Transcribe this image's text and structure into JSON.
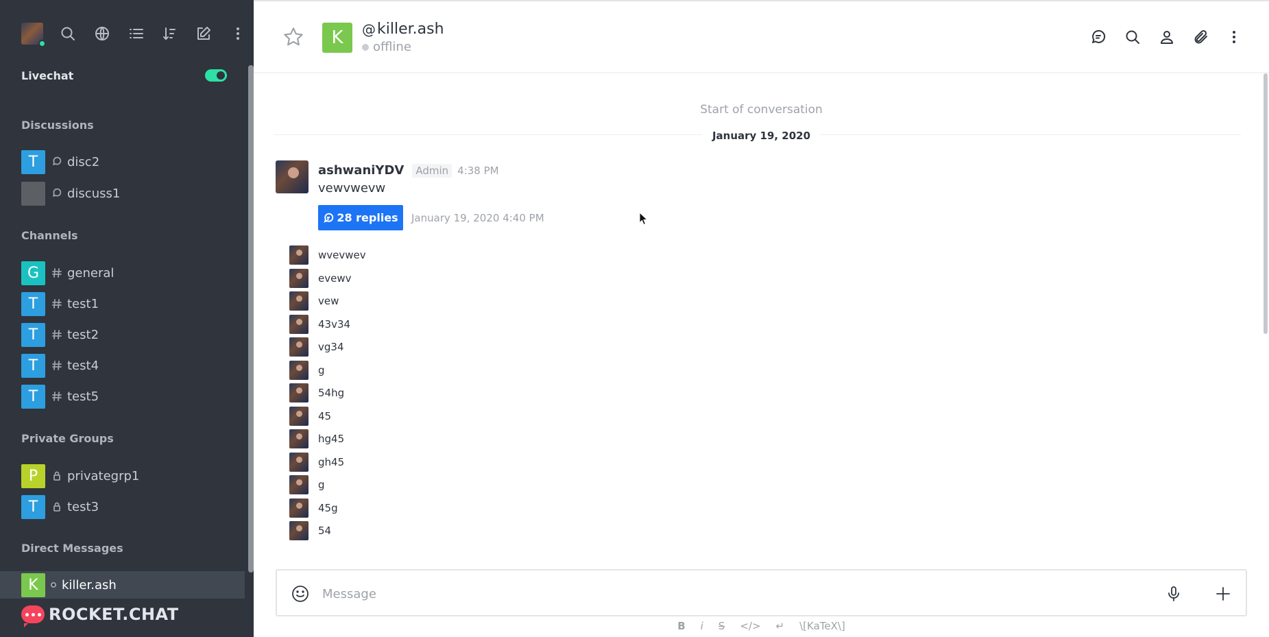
{
  "sidebar": {
    "livechat_label": "Livechat",
    "sections": {
      "discussions": "Discussions",
      "channels": "Channels",
      "private_groups": "Private Groups",
      "direct_messages": "Direct Messages"
    },
    "discussions": [
      {
        "initial": "T",
        "name": "disc2",
        "color": "#2d9ee0"
      },
      {
        "initial": "",
        "name": "discuss1",
        "color": "#5c6065"
      }
    ],
    "channels": [
      {
        "initial": "G",
        "name": "general",
        "color": "#1bc1c1"
      },
      {
        "initial": "T",
        "name": "test1",
        "color": "#2d9ee0"
      },
      {
        "initial": "T",
        "name": "test2",
        "color": "#2d9ee0"
      },
      {
        "initial": "T",
        "name": "test4",
        "color": "#2d9ee0"
      },
      {
        "initial": "T",
        "name": "test5",
        "color": "#2d9ee0"
      }
    ],
    "private_groups": [
      {
        "initial": "P",
        "name": "privategrp1",
        "color": "#b8d22a"
      },
      {
        "initial": "T",
        "name": "test3",
        "color": "#2d9ee0"
      }
    ],
    "direct_messages": [
      {
        "initial": "K",
        "name": "killer.ash",
        "color": "#7bc84e"
      }
    ],
    "brand": "ROCKET.CHAT"
  },
  "header": {
    "avatar_initial": "K",
    "username": "killer.ash",
    "status": "offline"
  },
  "conversation": {
    "start_label": "Start of conversation",
    "date": "January 19, 2020",
    "message": {
      "author": "ashwaniYDV",
      "role": "Admin",
      "time": "4:38 PM",
      "text": "vewvwevw",
      "replies_label": "28 replies",
      "last_reply": "January 19, 2020 4:40 PM"
    },
    "sequential": [
      "wvevwev",
      "evewv",
      "vew",
      "43v34",
      "vg34",
      "g",
      "54hg",
      "45",
      "hg45",
      "gh45",
      "g",
      "45g",
      "54"
    ]
  },
  "composer": {
    "placeholder": "Message",
    "formatting": [
      "B",
      "i",
      "S",
      "</>",
      "↵",
      "\\[KaTeX\\]"
    ]
  },
  "colors": {
    "sidebar_bg": "#2f343d",
    "accent": "#1d74f5",
    "online": "#2de0a5"
  }
}
